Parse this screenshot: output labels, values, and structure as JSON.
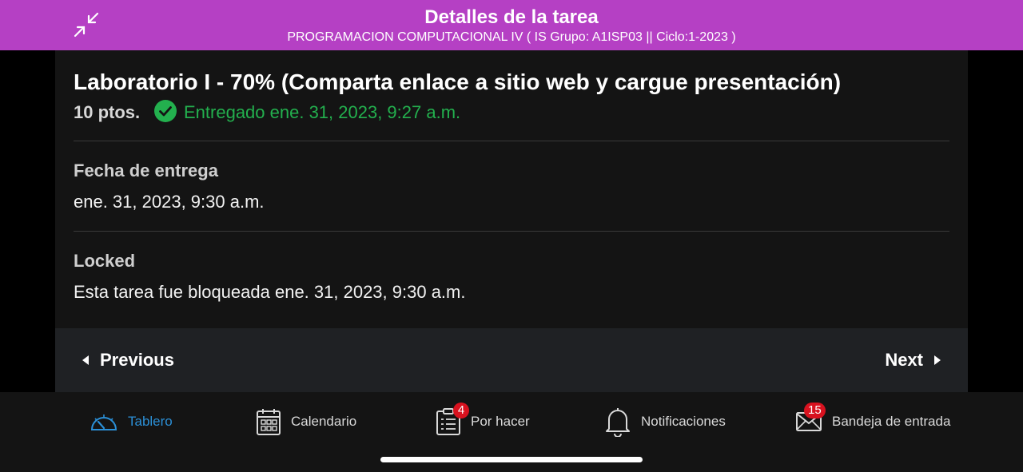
{
  "header": {
    "title": "Detalles de la tarea",
    "subtitle": "PROGRAMACION COMPUTACIONAL IV ( IS Grupo: A1ISP03 || Ciclo:1-2023 )",
    "collapse_icon": "collapse-arrows-icon"
  },
  "task": {
    "title": "Laboratorio I - 70% (Comparta enlace a sitio web y cargue presentación)",
    "points": "10 ptos.",
    "status": "Entregado ene. 31, 2023, 9:27 a.m.",
    "status_color": "#23b04e"
  },
  "sections": [
    {
      "label": "Fecha de entrega",
      "value": "ene. 31, 2023, 9:30 a.m."
    },
    {
      "label": "Locked",
      "value": "Esta tarea fue bloqueada ene. 31, 2023, 9:30 a.m."
    }
  ],
  "navigation": {
    "previous": "Previous",
    "next": "Next"
  },
  "tabs": [
    {
      "label": "Tablero",
      "icon": "dashboard-icon",
      "active": true
    },
    {
      "label": "Calendario",
      "icon": "calendar-icon"
    },
    {
      "label": "Por hacer",
      "icon": "todo-clipboard-icon",
      "badge": "4"
    },
    {
      "label": "Notificaciones",
      "icon": "bell-icon"
    },
    {
      "label": "Bandeja de entrada",
      "icon": "inbox-mail-icon",
      "badge": "15"
    }
  ],
  "colors": {
    "header_bg": "#b540c4",
    "accent": "#2b8fd6",
    "badge": "#d8121f"
  }
}
